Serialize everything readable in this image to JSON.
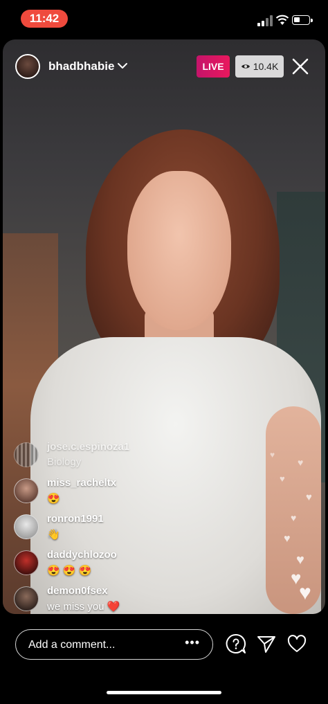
{
  "status_bar": {
    "time": "11:42"
  },
  "header": {
    "username": "bhadbhabie",
    "live_label": "LIVE",
    "viewer_count": "10.4K"
  },
  "comments": [
    {
      "username": "jose.c.espinoza1",
      "text": "Biology"
    },
    {
      "username": "miss_racheltx",
      "text": "😍"
    },
    {
      "username": "ronron1991",
      "text": "👋"
    },
    {
      "username": "daddychlozoo",
      "text": "😍 😍 😍"
    },
    {
      "username": "demon0fsex",
      "text": "we miss you ❤️"
    }
  ],
  "bottom_bar": {
    "comment_placeholder": "Add a comment...",
    "more_label": "•••"
  },
  "colors": {
    "live": "#e8185d",
    "time_pill": "#ef4a3d"
  },
  "icons": [
    "signal-icon",
    "wifi-icon",
    "battery-icon",
    "chevron-down-icon",
    "eye-icon",
    "close-icon",
    "question-icon",
    "send-icon",
    "heart-icon"
  ]
}
